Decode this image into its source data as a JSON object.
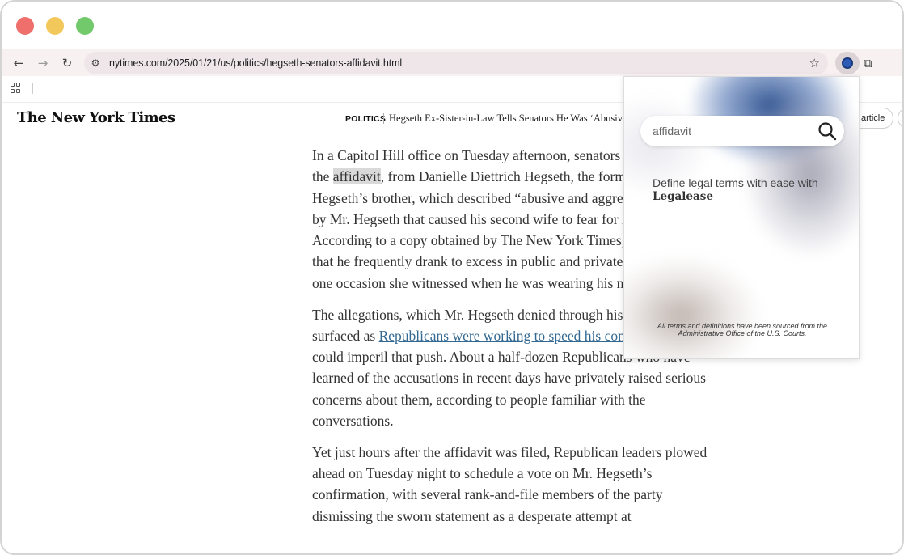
{
  "browser": {
    "url": "nytimes.com/2025/01/21/us/politics/hegseth-senators-affidavit.html",
    "nav_icons": {
      "back": "arrow-left-icon",
      "forward": "arrow-right-icon",
      "reload": "reload-icon"
    }
  },
  "nyt": {
    "logo": "The New York Times",
    "section": "POLITICS",
    "headline": "Hegseth Ex-Sister-in-Law Tells Senators He Was ‘Abusive’ to",
    "share_label": "article"
  },
  "article": {
    "p1": {
      "before": "In a Capitol Hill office on Tuesday afternoon, senators were reviewing the ",
      "highlight": "affidavit",
      "after": ", from Danielle Diettrich Hegseth, the former wife of Mr. Hegseth’s brother, which described “abusive and aggressive” behavior by Mr. Hegseth that caused his second wife to fear for her safety. According to a copy obtained by The New York Times, it also asserts that he frequently drank to excess in public and private, including on one occasion she witnessed when he was wearing his military uniform."
    },
    "p2": {
      "before": "The allegations, which Mr. Hegseth denied through his lawyer, surfaced as ",
      "link": "Republicans were working to speed his confirmation",
      "after": ", and could imperil that push. About a half-dozen Republicans who have learned of the accusations in recent days have privately raised serious concerns about them, according to people familiar with the conversations."
    },
    "p3": "Yet just hours after the affidavit was filed, Republican leaders plowed ahead on Tuesday night to schedule a vote on Mr. Hegseth’s confirmation, with several rank-and-file members of the party dismissing the sworn statement as a desperate attempt at"
  },
  "popup": {
    "search_value": "affidavit",
    "tagline": "Define legal terms with ease with",
    "brand": "Legalease",
    "footer_note": "All terms and definitions have been sourced from the Administrative Office of the U.S. Courts.",
    "colors": {
      "accent": "#2e5bb8",
      "gradient_blue": "#1c3f86"
    }
  }
}
